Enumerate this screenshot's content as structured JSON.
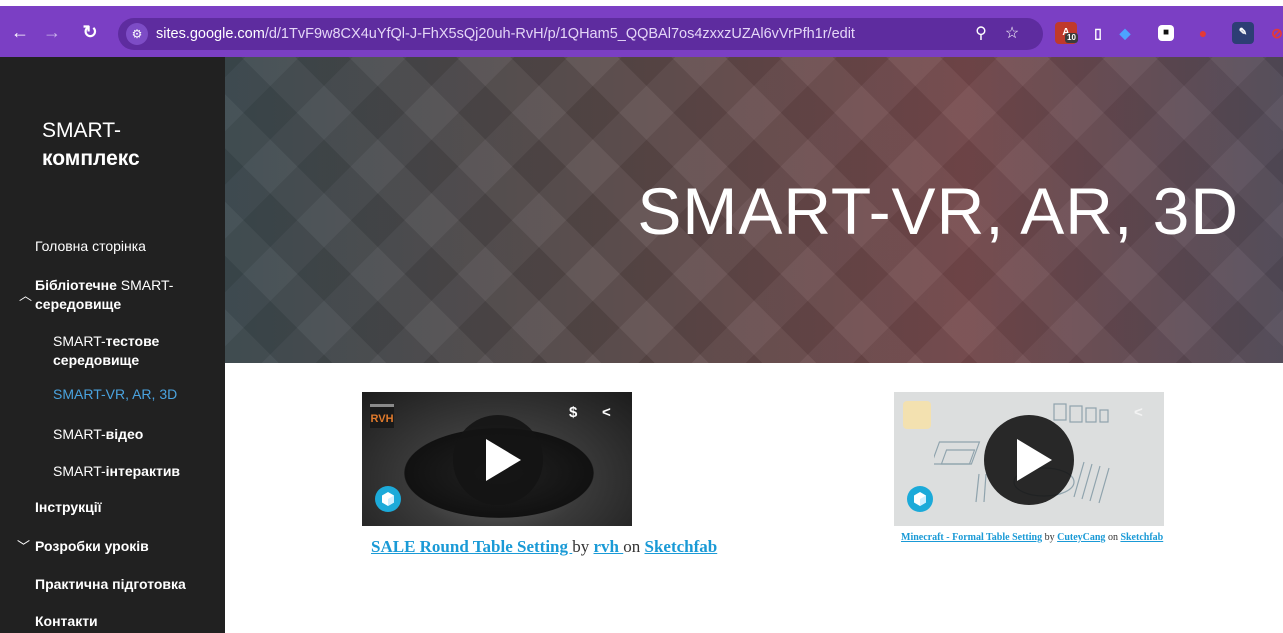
{
  "browser": {
    "url_host": "sites.google.com",
    "url_path": "/d/1TvF9w8CX4uYfQl-J-FhX5sQj20uh-RvH/p/1QHam5_QQBAl7os4zxxzUZAl6vVrPfh1r/edit",
    "extension_badge": "10",
    "icons": [
      "back-icon",
      "forward-icon",
      "reload-icon",
      "site-info-icon",
      "zoom-icon",
      "bookmark-star-icon"
    ],
    "accent_color": "#7b3fc4"
  },
  "sidebar": {
    "title_line1": "SMART-",
    "title_line2": "комплекс",
    "items": [
      {
        "label": "Головна сторінка"
      },
      {
        "label_bold": "Бібліотечне",
        "label_rest": " SMART-",
        "label_line2": "середовище"
      },
      {
        "label_rest": "SMART-",
        "label_bold": "тестове",
        "label_line2": "середовище"
      },
      {
        "label": "SMART-VR, AR, 3D"
      },
      {
        "label_rest": "SMART-",
        "label_bold": "відео"
      },
      {
        "label_rest": "SMART-",
        "label_bold": "інтерактив"
      },
      {
        "label": "Інструкції"
      },
      {
        "label": "Розробки уроків"
      },
      {
        "label": "Практична підготовка"
      },
      {
        "label": "Контакти"
      }
    ]
  },
  "banner": {
    "title": "SMART-VR, AR, 3D"
  },
  "embeds": [
    {
      "model_link": "SALE Round Table Setting ",
      "by": " by ",
      "author_link": "rvh ",
      "on": "on ",
      "platform_link": "Sketchfab",
      "badge": "RVH"
    },
    {
      "model_link": "Minecraft - Formal Table Setting",
      "by": " by ",
      "author_link": "CuteyCang",
      "on": " on ",
      "platform_link": "Sketchfab"
    }
  ]
}
